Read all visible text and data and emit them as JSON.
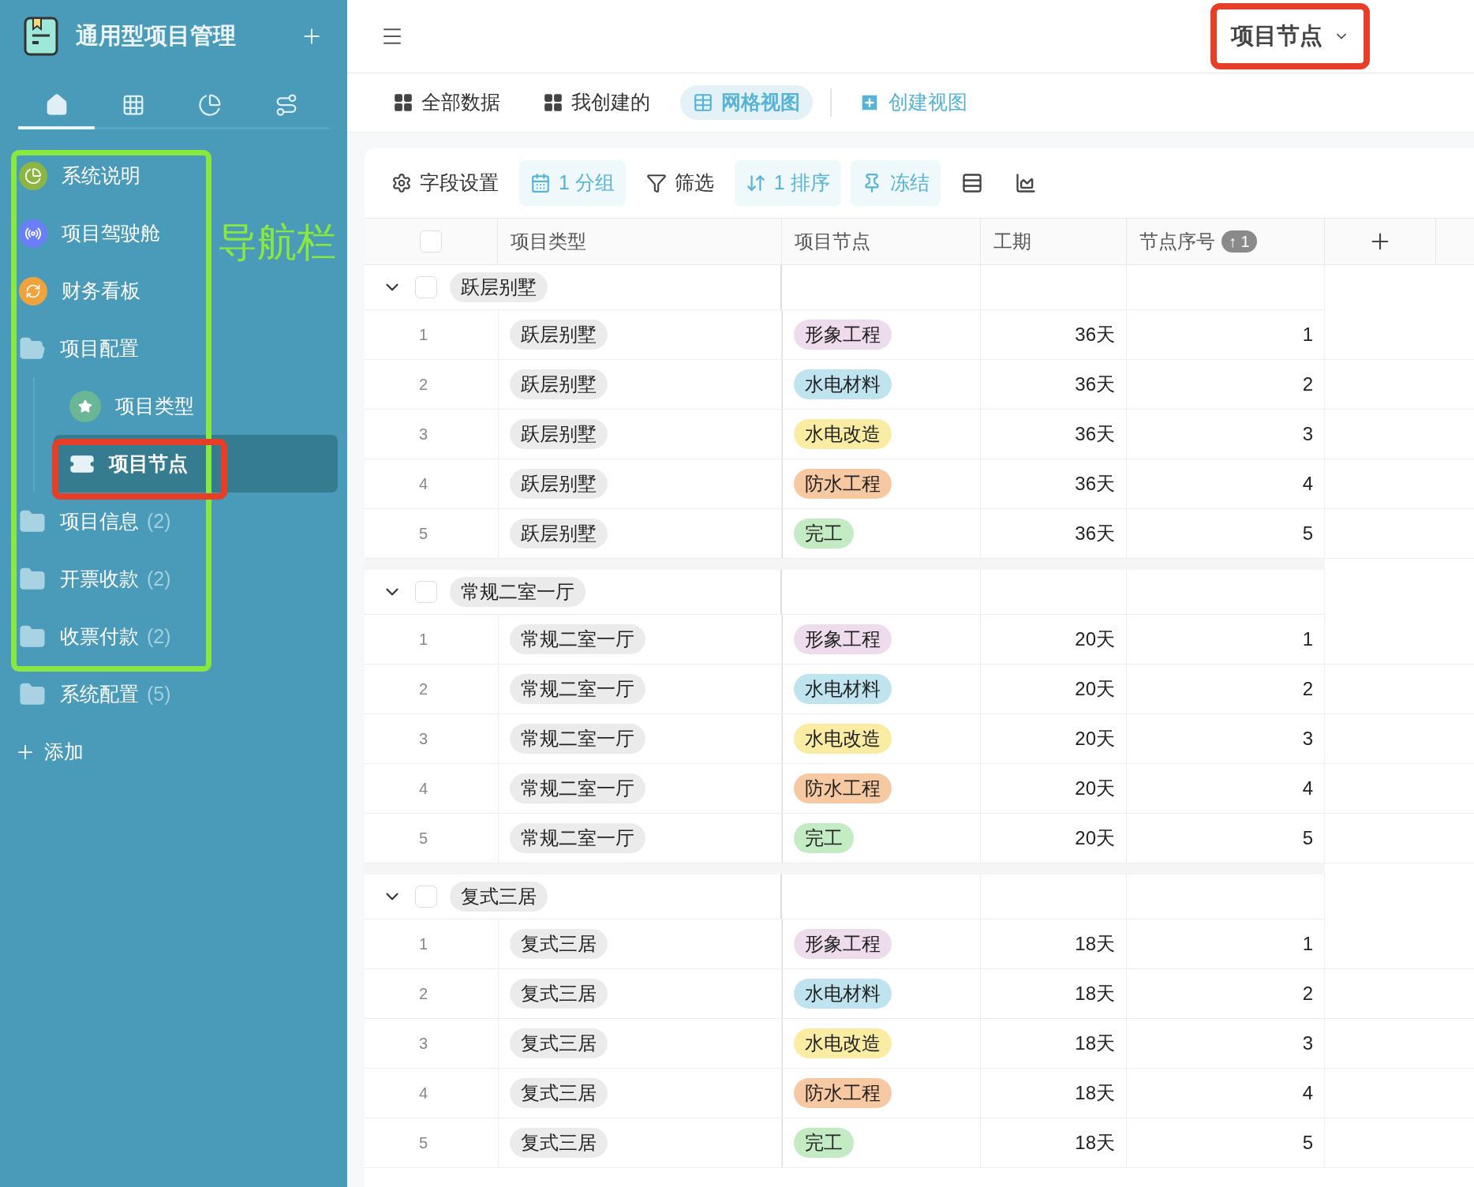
{
  "sidebar": {
    "title": "通用型项目管理",
    "tabs": [
      {
        "kind": "home",
        "selected": true
      },
      {
        "kind": "table",
        "selected": false
      },
      {
        "kind": "chart",
        "selected": false
      },
      {
        "kind": "flow",
        "selected": false
      }
    ],
    "items": [
      {
        "label": "系统说明",
        "kind": "pie",
        "selected": false
      },
      {
        "label": "项目驾驶舱",
        "kind": "radar",
        "selected": false
      },
      {
        "label": "财务看板",
        "kind": "sync",
        "selected": false
      },
      {
        "label": "项目配置",
        "kind": "folder-open",
        "selected": false,
        "children": [
          {
            "label": "项目类型",
            "kind": "ticket-star",
            "selected": false
          },
          {
            "label": "项目节点",
            "kind": "ticket",
            "selected": true
          }
        ]
      },
      {
        "label": "项目信息",
        "kind": "folder",
        "count": "(2)",
        "selected": false
      },
      {
        "label": "开票收款",
        "kind": "folder",
        "count": "(2)",
        "selected": false
      },
      {
        "label": "收票付款",
        "kind": "folder",
        "count": "(2)",
        "selected": false
      },
      {
        "label": "系统配置",
        "kind": "folder",
        "count": "(5)",
        "selected": false
      }
    ],
    "add_label": "添加"
  },
  "annotation_label": "导航栏",
  "topbar": {
    "page_selector": "项目节点"
  },
  "view_tabs": [
    {
      "label": "全部数据",
      "kind": "view",
      "selected": false
    },
    {
      "label": "我创建的",
      "kind": "view",
      "selected": false
    },
    {
      "label": "网格视图",
      "kind": "view",
      "selected": true
    },
    {
      "label": "创建视图",
      "kind": "create"
    }
  ],
  "toolbar": [
    {
      "label": "字段设置",
      "kind": "settings",
      "active": false
    },
    {
      "label": "1 分组",
      "kind": "group",
      "active": true
    },
    {
      "label": "筛选",
      "kind": "filter",
      "active": false
    },
    {
      "label": "1 排序",
      "kind": "sort",
      "active": true
    },
    {
      "label": "冻结",
      "kind": "pin",
      "active": true
    },
    {
      "kind": "row-height",
      "active": false
    },
    {
      "kind": "chart",
      "active": false
    }
  ],
  "table": {
    "header_checked": false,
    "columns": [
      {
        "label": "项目类型"
      },
      {
        "label": "项目节点"
      },
      {
        "label": "工期"
      },
      {
        "label": "节点序号",
        "badge": "↑ 1"
      }
    ],
    "groups": [
      {
        "label": "跃层别墅",
        "expanded": true,
        "checked": false,
        "rows": [
          {
            "index": "1",
            "type": "跃层别墅",
            "node": "形象工程",
            "color": "#eedcec",
            "duration": "36天",
            "order": "1"
          },
          {
            "index": "2",
            "type": "跃层别墅",
            "node": "水电材料",
            "color": "#bfe4ef",
            "duration": "36天",
            "order": "2"
          },
          {
            "index": "3",
            "type": "跃层别墅",
            "node": "水电改造",
            "color": "#faeca2",
            "duration": "36天",
            "order": "3"
          },
          {
            "index": "4",
            "type": "跃层别墅",
            "node": "防水工程",
            "color": "#f7c9a3",
            "duration": "36天",
            "order": "4"
          },
          {
            "index": "5",
            "type": "跃层别墅",
            "node": "完工",
            "color": "#c4ecc4",
            "duration": "36天",
            "order": "5"
          }
        ]
      },
      {
        "label": "常规二室一厅",
        "expanded": true,
        "checked": false,
        "rows": [
          {
            "index": "1",
            "type": "常规二室一厅",
            "node": "形象工程",
            "color": "#eedcec",
            "duration": "20天",
            "order": "1"
          },
          {
            "index": "2",
            "type": "常规二室一厅",
            "node": "水电材料",
            "color": "#bfe4ef",
            "duration": "20天",
            "order": "2"
          },
          {
            "index": "3",
            "type": "常规二室一厅",
            "node": "水电改造",
            "color": "#faeca2",
            "duration": "20天",
            "order": "3"
          },
          {
            "index": "4",
            "type": "常规二室一厅",
            "node": "防水工程",
            "color": "#f7c9a3",
            "duration": "20天",
            "order": "4"
          },
          {
            "index": "5",
            "type": "常规二室一厅",
            "node": "完工",
            "color": "#c4ecc4",
            "duration": "20天",
            "order": "5"
          }
        ]
      },
      {
        "label": "复式三居",
        "expanded": true,
        "checked": false,
        "rows": [
          {
            "index": "1",
            "type": "复式三居",
            "node": "形象工程",
            "color": "#eedcec",
            "duration": "18天",
            "order": "1"
          },
          {
            "index": "2",
            "type": "复式三居",
            "node": "水电材料",
            "color": "#bfe4ef",
            "duration": "18天",
            "order": "2"
          },
          {
            "index": "3",
            "type": "复式三居",
            "node": "水电改造",
            "color": "#faeca2",
            "duration": "18天",
            "order": "3"
          },
          {
            "index": "4",
            "type": "复式三居",
            "node": "防水工程",
            "color": "#f7c9a3",
            "duration": "18天",
            "order": "4"
          },
          {
            "index": "5",
            "type": "复式三居",
            "node": "完工",
            "color": "#c4ecc4",
            "duration": "18天",
            "order": "5"
          }
        ]
      }
    ]
  }
}
